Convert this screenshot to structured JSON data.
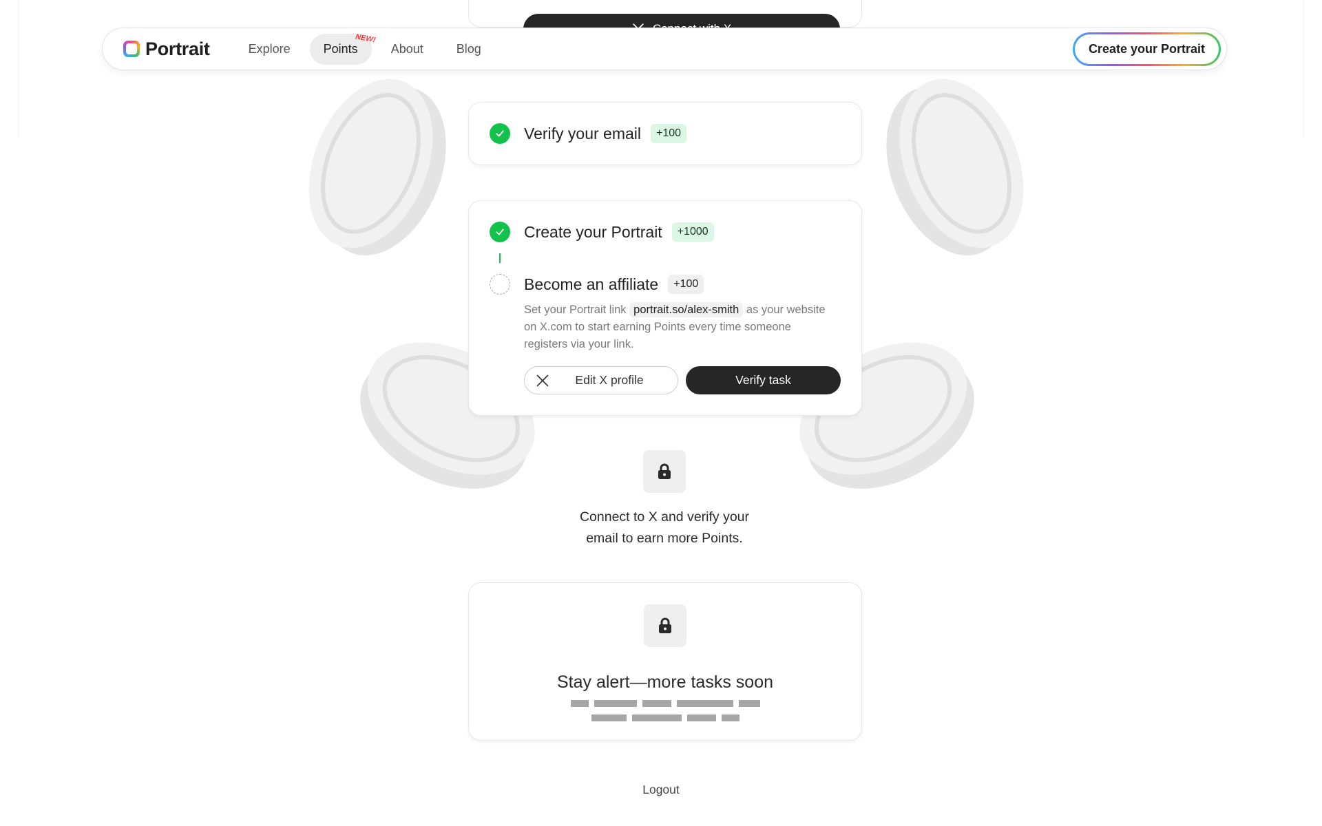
{
  "top_button": {
    "label": "Connect with X",
    "icon": "x-logo-icon"
  },
  "nav": {
    "brand": "Portrait",
    "links": [
      {
        "label": "Explore"
      },
      {
        "label": "Points",
        "tag": "NEW!",
        "active": true
      },
      {
        "label": "About"
      },
      {
        "label": "Blog"
      }
    ],
    "cta": "Create your Portrait"
  },
  "tasks": {
    "verify_email": {
      "title": "Verify your email",
      "points": "+100",
      "status": "completed"
    },
    "create_portrait": {
      "title": "Create your Portrait",
      "points": "+1000",
      "status": "completed"
    },
    "affiliate": {
      "title": "Become an affiliate",
      "points": "+100",
      "status": "pending",
      "desc_before": "Set your Portrait link",
      "link": "portrait.so/alex-smith",
      "desc_after": "as your website on X.com to start earning Points every time someone registers via your link.",
      "edit_button": "Edit X profile",
      "verify_button": "Verify task"
    }
  },
  "locked": {
    "icon": "lock-icon",
    "line1": "Connect to X and verify your",
    "line2": "email to earn more Points."
  },
  "coming_soon": {
    "icon": "lock-icon",
    "title": "Stay alert—more tasks soon"
  },
  "logout": "Logout",
  "colors": {
    "success": "#12c24a",
    "dark_button": "#262626",
    "badge_green_bg": "#dcf7e6"
  }
}
